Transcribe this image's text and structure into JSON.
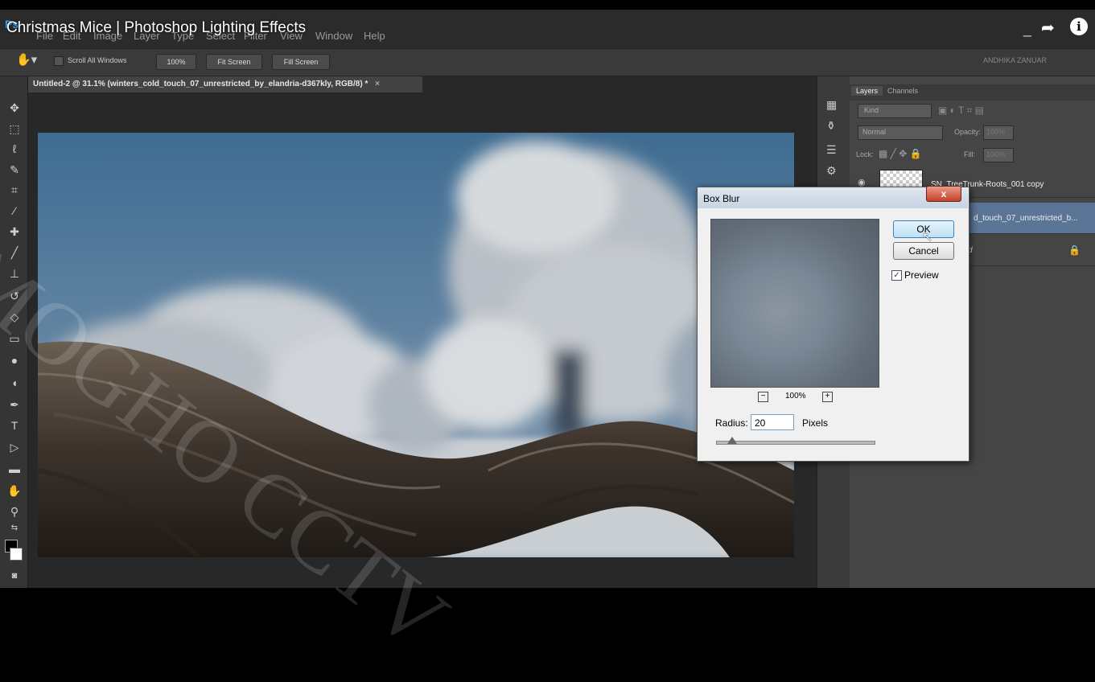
{
  "video": {
    "title": "Christmas Mice | Photoshop Lighting Effects",
    "share_icon": "share-arrow-icon",
    "info_icon": "info-icon",
    "info_glyph": "i",
    "minimize_glyph": "_"
  },
  "menubar": {
    "logo": "Ps",
    "items": [
      "File",
      "Edit",
      "Image",
      "Layer",
      "Type",
      "Select",
      "Filter",
      "View",
      "Window",
      "Help"
    ]
  },
  "options": {
    "scroll_all_windows": "Scroll All Windows",
    "zoom_100": "100%",
    "fit_screen": "Fit Screen",
    "fill_screen": "Fill Screen",
    "workspace": "ANDHIKA ZANUAR"
  },
  "document": {
    "tab_title": "Untitled-2 @ 31.1% (winters_cold_touch_07_unrestricted_by_elandria-d367kly, RGB/8) *",
    "tab_close": "×"
  },
  "layers_panel": {
    "tabs": [
      "Layers",
      "Channels"
    ],
    "kind_label": "Kind",
    "blend_mode": "Normal",
    "opacity_label": "Opacity:",
    "opacity_value": "100%",
    "lock_label": "Lock:",
    "fill_label": "Fill:",
    "fill_value": "100%",
    "layers": [
      {
        "name": "SN_TreeTrunk-Roots_001 copy"
      },
      {
        "name": "d_touch_07_unrestricted_b..."
      },
      {
        "name": "d"
      }
    ]
  },
  "dialog": {
    "title": "Box Blur",
    "close_glyph": "x",
    "ok_label": "OK",
    "cancel_label": "Cancel",
    "preview_label": "Preview",
    "preview_checked": true,
    "zoom_level": "100%",
    "radius_label": "Radius:",
    "radius_value": "20",
    "pixels_label": "Pixels",
    "radius_slider_fraction": 0.1
  },
  "colors": {
    "accent": "#31a8ff",
    "sky": "#4c7699",
    "foreground": "#000000",
    "background": "#ffffff"
  }
}
